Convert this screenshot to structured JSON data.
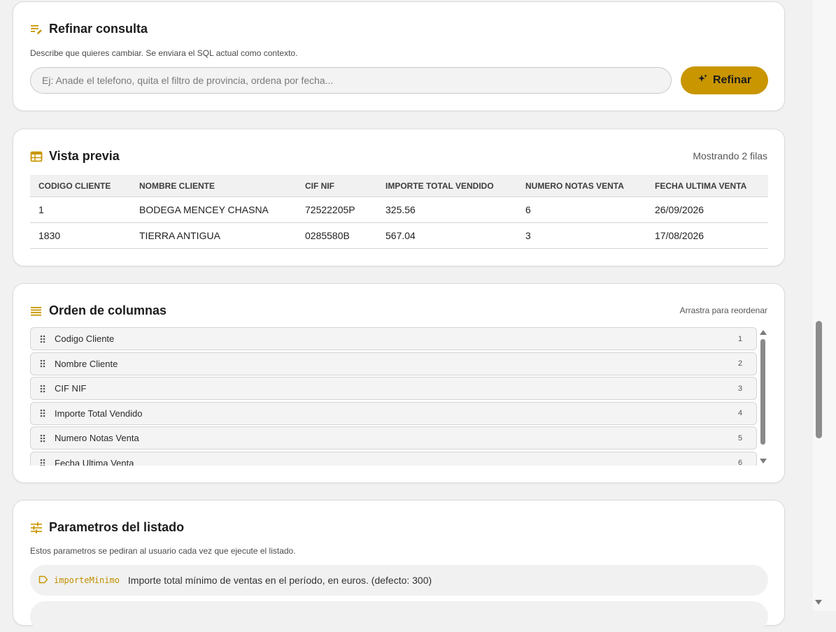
{
  "refine": {
    "title": "Refinar consulta",
    "description": "Describe que quieres cambiar. Se enviara el SQL actual como contexto.",
    "input_placeholder": "Ej: Anade el telefono, quita el filtro de provincia, ordena por fecha...",
    "input_value": "",
    "button_label": "Refinar"
  },
  "preview": {
    "title": "Vista previa",
    "row_count_text": "Mostrando 2 filas",
    "columns": [
      "CODIGO CLIENTE",
      "NOMBRE CLIENTE",
      "CIF NIF",
      "IMPORTE TOTAL VENDIDO",
      "NUMERO NOTAS VENTA",
      "FECHA ULTIMA VENTA"
    ],
    "rows": [
      [
        "1",
        "BODEGA MENCEY CHASNA",
        "72522205P",
        "325.56",
        "6",
        "26/09/2026"
      ],
      [
        "1830",
        "TIERRA ANTIGUA",
        "0285580B",
        "567.04",
        "3",
        "17/08/2026"
      ]
    ]
  },
  "order": {
    "title": "Orden de columnas",
    "hint": "Arrastra para reordenar",
    "items": [
      {
        "label": "Codigo Cliente",
        "index": "1"
      },
      {
        "label": "Nombre Cliente",
        "index": "2"
      },
      {
        "label": "CIF NIF",
        "index": "3"
      },
      {
        "label": "Importe Total Vendido",
        "index": "4"
      },
      {
        "label": "Numero Notas Venta",
        "index": "5"
      },
      {
        "label": "Fecha Ultima Venta",
        "index": "6"
      }
    ]
  },
  "params": {
    "title": "Parametros del listado",
    "description": "Estos parametros se pediran al usuario cada vez que ejecute el listado.",
    "items": [
      {
        "name": "importeMinimo",
        "description": "Importe total mínimo de ventas en el período, en euros. (defecto: 300)"
      }
    ]
  },
  "colors": {
    "accent": "#c99600",
    "card_bg": "#ffffff",
    "page_bg": "#f1f1f1"
  }
}
